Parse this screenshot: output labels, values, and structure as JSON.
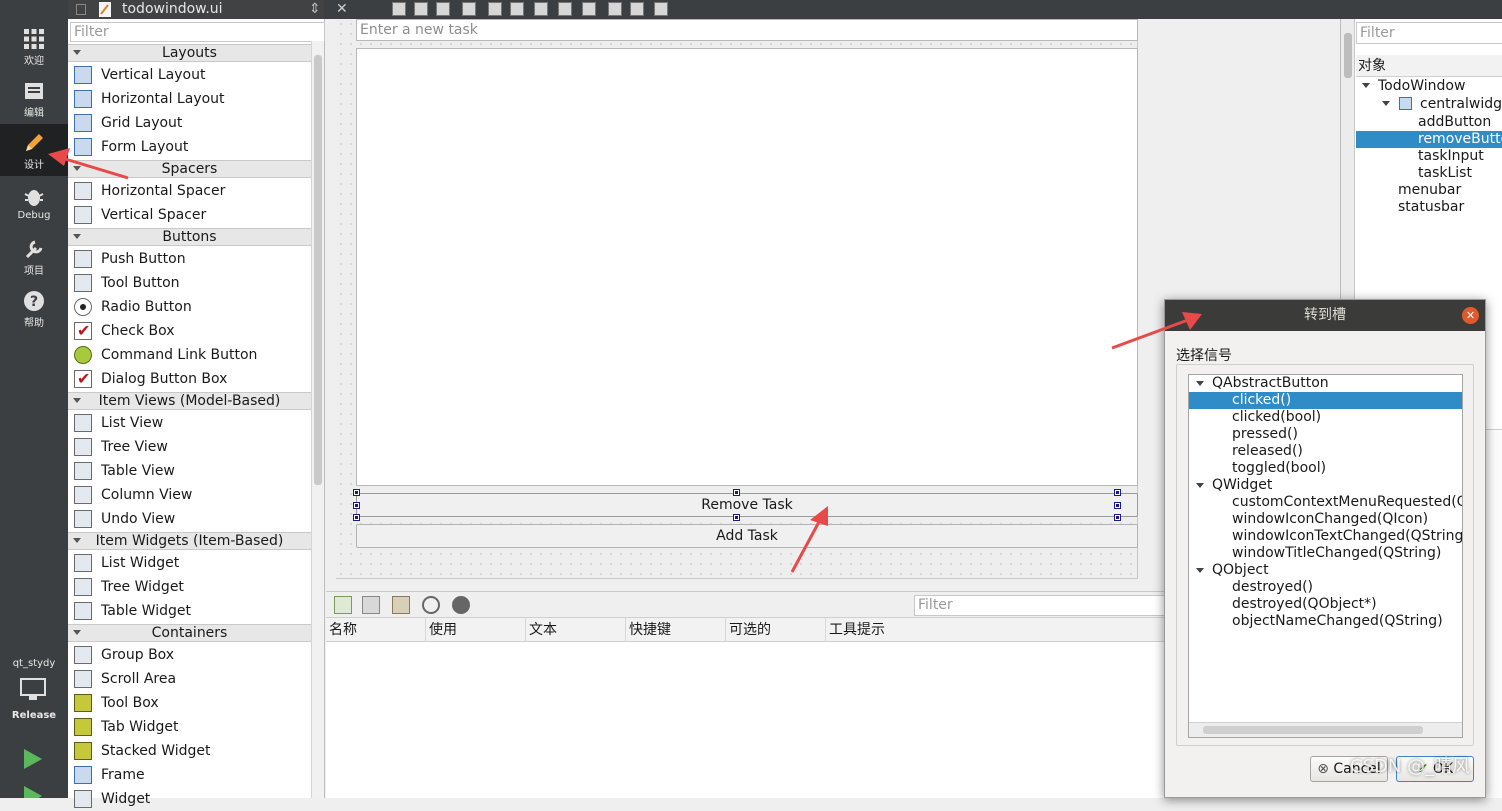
{
  "topbar": {
    "file_name": "todowindow.ui"
  },
  "modebar": {
    "items": [
      {
        "label": "欢迎"
      },
      {
        "label": "编辑"
      },
      {
        "label": "设计"
      },
      {
        "label": "Debug"
      },
      {
        "label": "项目"
      },
      {
        "label": "帮助"
      }
    ],
    "project": "qt_stydy",
    "build": "Release"
  },
  "widget_box": {
    "filter_placeholder": "Filter",
    "categories": [
      {
        "label": "Layouts",
        "items": [
          "Vertical Layout",
          "Horizontal Layout",
          "Grid Layout",
          "Form Layout"
        ]
      },
      {
        "label": "Spacers",
        "items": [
          "Horizontal Spacer",
          "Vertical Spacer"
        ]
      },
      {
        "label": "Buttons",
        "items": [
          "Push Button",
          "Tool Button",
          "Radio Button",
          "Check Box",
          "Command Link Button",
          "Dialog Button Box"
        ]
      },
      {
        "label": "Item Views (Model-Based)",
        "items": [
          "List View",
          "Tree View",
          "Table View",
          "Column View",
          "Undo View"
        ]
      },
      {
        "label": "Item Widgets (Item-Based)",
        "items": [
          "List Widget",
          "Tree Widget",
          "Table Widget"
        ]
      },
      {
        "label": "Containers",
        "items": [
          "Group Box",
          "Scroll Area",
          "Tool Box",
          "Tab Widget",
          "Stacked Widget",
          "Frame",
          "Widget"
        ]
      }
    ]
  },
  "form": {
    "task_input_placeholder": "Enter a new task",
    "remove_button": "Remove Task",
    "add_button": "Add Task"
  },
  "action_editor": {
    "filter_placeholder": "Filter",
    "columns": [
      "名称",
      "使用",
      "文本",
      "快捷键",
      "可选的",
      "工具提示"
    ]
  },
  "object_inspector": {
    "filter_placeholder": "Filter",
    "header": "对象",
    "items": [
      "TodoWindow",
      "centralwidget",
      "addButton",
      "removeButton",
      "taskInput",
      "taskList",
      "menubar",
      "statusbar"
    ],
    "selected": "removeButton"
  },
  "dialog": {
    "title": "转到槽",
    "label": "选择信号",
    "groups": [
      {
        "name": "QAbstractButton",
        "signals": [
          "clicked()",
          "clicked(bool)",
          "pressed()",
          "released()",
          "toggled(bool)"
        ]
      },
      {
        "name": "QWidget",
        "signals": [
          "customContextMenuRequested(QPoint)",
          "windowIconChanged(QIcon)",
          "windowIconTextChanged(QString)",
          "windowTitleChanged(QString)"
        ]
      },
      {
        "name": "QObject",
        "signals": [
          "destroyed()",
          "destroyed(QObject*)",
          "objectNameChanged(QString)"
        ]
      }
    ],
    "selected_signal": "clicked()",
    "cancel": "Cancel",
    "ok": "OK"
  },
  "watermark": "CSDN @_晴风",
  "colors": {
    "selection": "#308cc6",
    "arrow": "#e84a4a",
    "dark_panel": "#3c3f41"
  }
}
